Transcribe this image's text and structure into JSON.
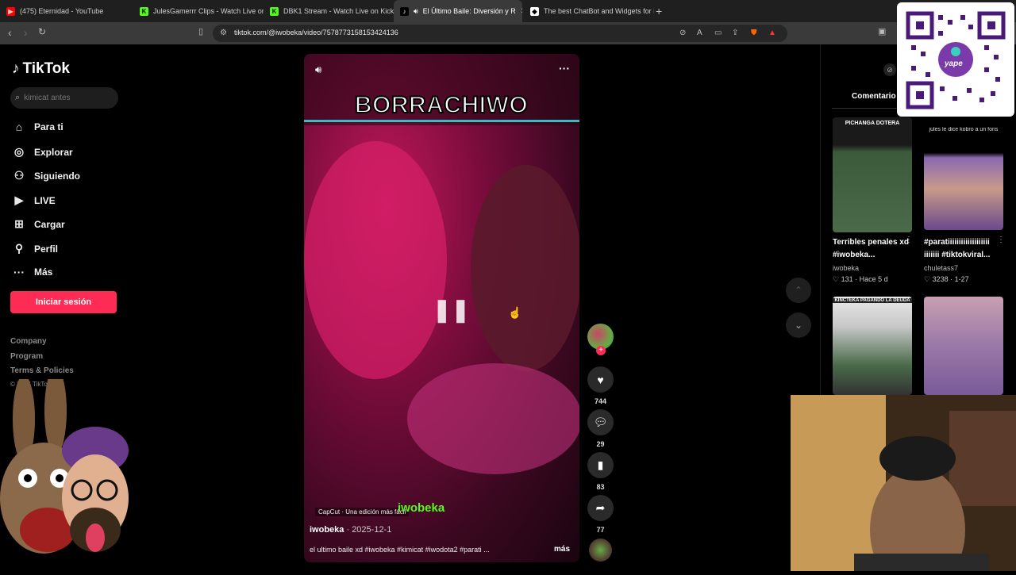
{
  "browser": {
    "tabs": [
      {
        "title": "(475) Eternidad - YouTube",
        "icon": "youtube-icon",
        "color": "#ff0000"
      },
      {
        "title": "JulesGamerrr Clips - Watch Live on K",
        "icon": "kick-icon",
        "color": "#53fc18"
      },
      {
        "title": "DBK1 Stream - Watch Live on Kick",
        "icon": "kick-icon",
        "color": "#53fc18"
      },
      {
        "title": "El Último Baile: Diversión y R",
        "icon": "tiktok-icon",
        "color": "#000000",
        "active": true
      },
      {
        "title": "The best ChatBot and Widgets for Ki",
        "icon": "bot-icon",
        "color": "#ffffff"
      }
    ],
    "url": "tiktok.com/@iwobeka/video/7578773158153424136"
  },
  "sidebar": {
    "brand": "TikTok",
    "search_placeholder": "kimicat antes",
    "nav": [
      {
        "label": "Para ti",
        "icon": "home-icon"
      },
      {
        "label": "Explorar",
        "icon": "compass-icon"
      },
      {
        "label": "Siguiendo",
        "icon": "following-icon"
      },
      {
        "label": "LIVE",
        "icon": "live-icon"
      },
      {
        "label": "Cargar",
        "icon": "upload-icon"
      },
      {
        "label": "Perfil",
        "icon": "profile-icon"
      },
      {
        "label": "Más",
        "icon": "more-icon"
      }
    ],
    "login_label": "Iniciar sesión",
    "footer": [
      "Company",
      "Program",
      "Terms & Policies",
      "© 2026 TikTok"
    ]
  },
  "video": {
    "caption_title": "BORRACHIWO",
    "watermark": "iwobeka",
    "capcut": "CapCut · Una edición más fácil",
    "author": "iwobeka",
    "date": "· 2025-12-1",
    "description": "el ultimo baile xd #iwobeka #kimicat #iwodota2 #parati ...",
    "more": "más",
    "likes": "744",
    "comments": "29",
    "saves": "83",
    "shares": "77"
  },
  "right_panel": {
    "comments_tab": "Comentario",
    "related": [
      {
        "title": "Terribles penales xd #iwobeka...",
        "author": "iwobeka",
        "views": "131",
        "age": "Hace 5 d",
        "thumb_caption": "PICHANGA DOTERA"
      },
      {
        "title": "#paratiiiiiiiiiiiiiiiiiii iiiiiii #tiktokviral...",
        "author": "chuletass7",
        "views": "3238",
        "age": "1-27",
        "thumb_caption": "jules le dice kobro a un fons"
      },
      {
        "thumb_caption": "KINCTEKA PAGANDO LA DEUDA"
      },
      {
        "thumb_caption": ""
      }
    ]
  },
  "overlays": {
    "qr_brand": "yape"
  }
}
